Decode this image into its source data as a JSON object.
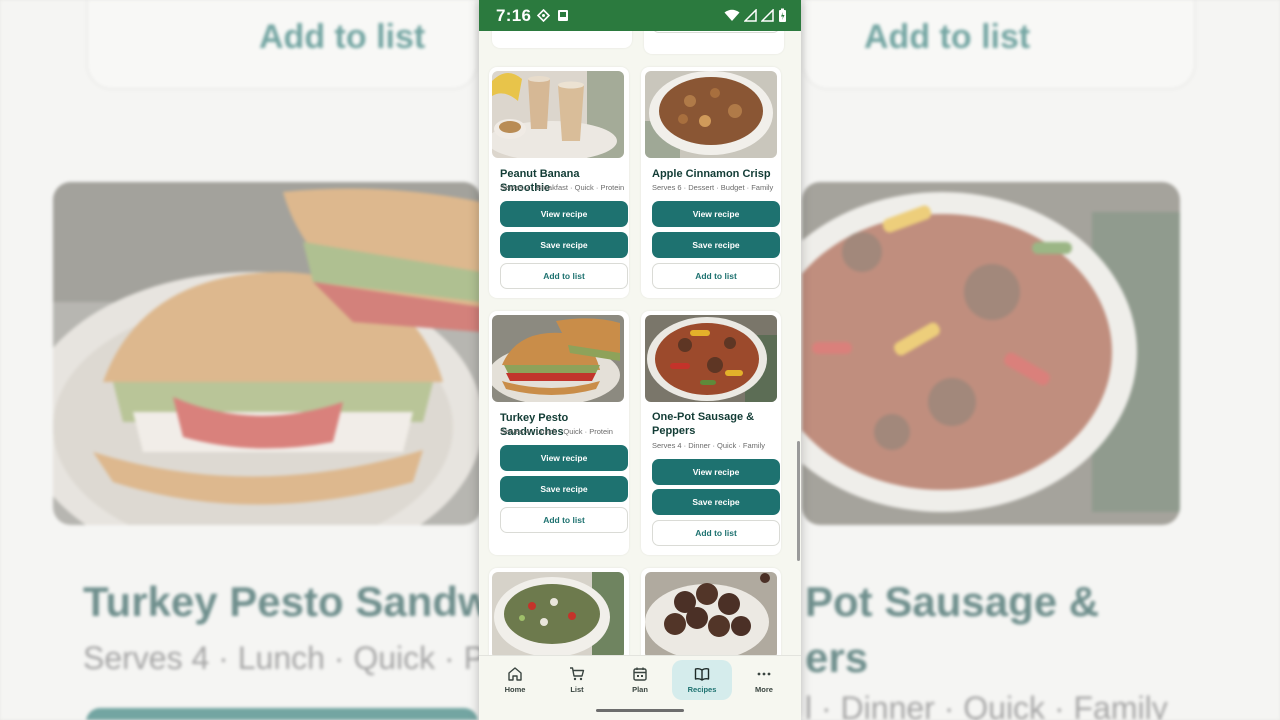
{
  "status_bar": {
    "time": "7:16"
  },
  "recipes": [
    {
      "title": "Peanut Banana Smoothie",
      "meta": "Serves 2 · Breakfast · Quick · Protein"
    },
    {
      "title": "Apple Cinnamon Crisp",
      "meta": "Serves 6 · Dessert · Budget · Family"
    },
    {
      "title": "Turkey Pesto Sandwiches",
      "meta": "Serves 4 · Lunch · Quick · Protein"
    },
    {
      "title": "One-Pot Sausage & Peppers",
      "meta": "Serves 4 · Dinner · Quick · Family"
    }
  ],
  "buttons": {
    "view": "View recipe",
    "save": "Save recipe",
    "add": "Add to list"
  },
  "nav": [
    {
      "label": "Home",
      "icon": "home-icon"
    },
    {
      "label": "List",
      "icon": "cart-icon"
    },
    {
      "label": "Plan",
      "icon": "calendar-icon"
    },
    {
      "label": "Recipes",
      "icon": "book-icon"
    },
    {
      "label": "More",
      "icon": "more-icon"
    }
  ],
  "background": {
    "add_label": "Add to list",
    "title_left": "Turkey Pesto Sandw",
    "meta_left": "Serves 4 · Lunch · Quick · Pro",
    "title_right_1": "Pot Sausage &",
    "title_right_2": "ers",
    "meta_right": "l · Dinner · Quick · Family"
  },
  "colors": {
    "status_bar": "#2b7a3e",
    "primary": "#1e7270",
    "active_nav": "#d5ecec"
  }
}
